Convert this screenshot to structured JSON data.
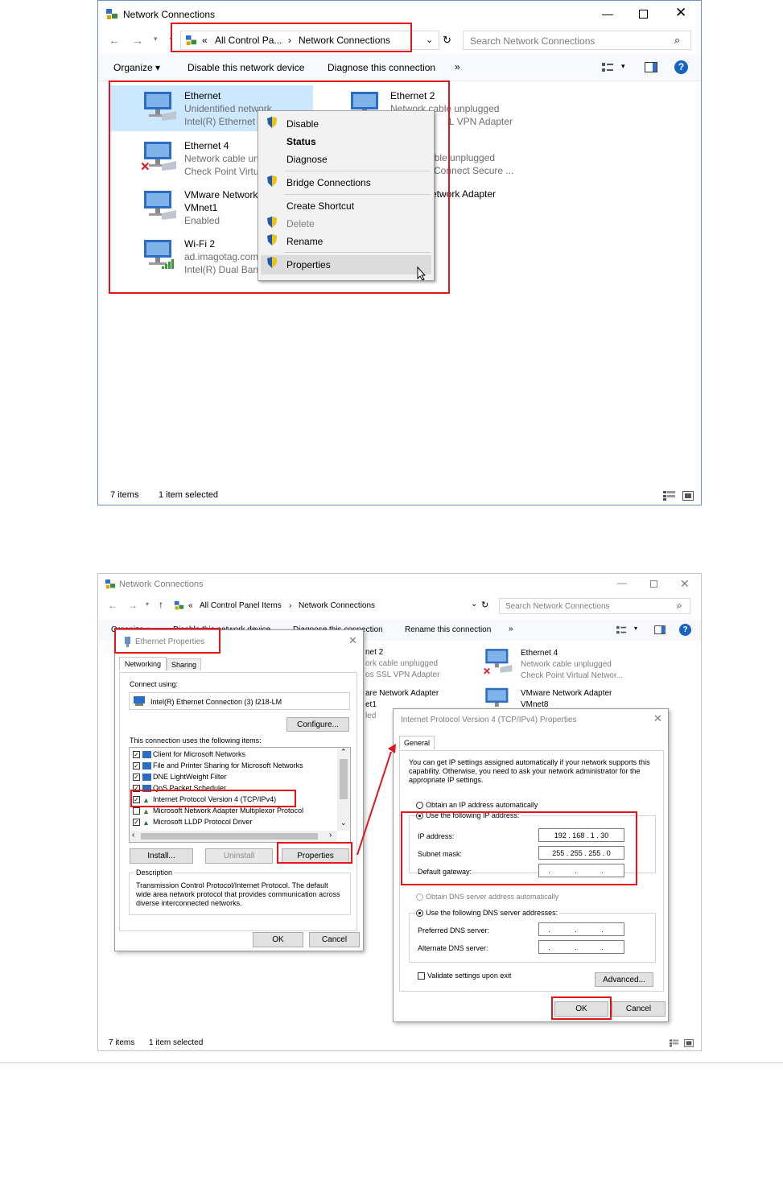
{
  "win1": {
    "title": "Network Connections",
    "breadcrumb_prefix": "«",
    "breadcrumb_parent": "All Control Pa...",
    "breadcrumb_sep": "›",
    "breadcrumb_current": "Network Connections",
    "search_placeholder": "Search Network Connections",
    "toolbar": {
      "organize": "Organize ▾",
      "disable": "Disable this network device",
      "diagnose": "Diagnose this connection",
      "more": "»"
    },
    "items": [
      {
        "name": "Ethernet",
        "line2": "Unidentified network",
        "line3": "Intel(R) Ethernet"
      },
      {
        "name": "Ethernet 4",
        "line2": "Network cable un",
        "line3": "Check Point Virtu"
      },
      {
        "name": "VMware Network",
        "line2": "VMnet1",
        "line3": "Enabled"
      },
      {
        "name": "Wi-Fi 2",
        "line2": "ad.imagotag.com",
        "line3": "Intel(R) Dual Band"
      },
      {
        "name": "Ethernet 2",
        "line2": "Network cable unplugged",
        "line3": "L VPN Adapter"
      },
      {
        "name": "",
        "line2": "able unplugged",
        "line3": "Connect Secure ..."
      },
      {
        "name": "etwork Adapter",
        "line2": "",
        "line3": ""
      }
    ],
    "context_menu": [
      "Disable",
      "Status",
      "Diagnose",
      "Bridge Connections",
      "Create Shortcut",
      "Delete",
      "Rename",
      "Properties"
    ],
    "status_items": "7 items",
    "status_selected": "1 item selected"
  },
  "win2": {
    "title": "Network Connections",
    "breadcrumb_prefix": "«",
    "breadcrumb_parent": "All Control Panel Items",
    "breadcrumb_sep": "›",
    "breadcrumb_current": "Network Connections",
    "search_placeholder": "Search Network Connections",
    "toolbar": {
      "organize": "Organize ▾",
      "disable": "Disable this network device",
      "diagnose": "Diagnose this connection",
      "rename": "Rename this connection",
      "more": "»"
    },
    "bg_items": [
      {
        "name": "net 2",
        "line2": "ork cable unplugged",
        "line3": "os SSL VPN Adapter"
      },
      {
        "name": "are Network Adapter",
        "line2": "et1",
        "line3": "led"
      },
      {
        "name": "Ethernet 4",
        "line2": "Network cable unplugged",
        "line3": "Check Point Virtual Networ..."
      },
      {
        "name": "VMware Network Adapter",
        "line2": "VMnet8",
        "line3": ""
      }
    ],
    "status_items": "7 items",
    "status_selected": "1 item selected"
  },
  "eth_props": {
    "title": "Ethernet Properties",
    "tab_networking": "Networking",
    "tab_sharing": "Sharing",
    "connect_using": "Connect using:",
    "adapter": "Intel(R) Ethernet Connection (3) I218-LM",
    "configure": "Configure...",
    "uses_label": "This connection uses the following items:",
    "items": [
      "Client for Microsoft Networks",
      "File and Printer Sharing for Microsoft Networks",
      "DNE LightWeight Filter",
      "QoS Packet Scheduler",
      "Internet Protocol Version 4 (TCP/IPv4)",
      "Microsoft Network Adapter Multiplexor Protocol",
      "Microsoft LLDP Protocol Driver"
    ],
    "install": "Install...",
    "uninstall": "Uninstall",
    "properties": "Properties",
    "description_label": "Description",
    "description": "Transmission Control Protocol/Internet Protocol. The default wide area network protocol that provides communication across diverse interconnected networks.",
    "ok": "OK",
    "cancel": "Cancel"
  },
  "ipv4": {
    "title": "Internet Protocol Version 4 (TCP/IPv4) Properties",
    "tab_general": "General",
    "intro": "You can get IP settings assigned automatically if your network supports this capability. Otherwise, you need to ask your network administrator for the appropriate IP settings.",
    "obtain_auto": "Obtain an IP address automatically",
    "use_following": "Use the following IP address:",
    "ip_label": "IP address:",
    "ip_value": "192 . 168 . 1 . 30",
    "mask_label": "Subnet mask:",
    "mask_value": "255 . 255 . 255 . 0",
    "gateway_label": "Default gateway:",
    "gateway_value": ". . .",
    "dns_auto": "Obtain DNS server address automatically",
    "dns_use": "Use the following DNS server addresses:",
    "preferred": "Preferred DNS server:",
    "preferred_value": ". . .",
    "alternate": "Alternate DNS server:",
    "alternate_value": ". . .",
    "validate": "Validate settings upon exit",
    "advanced": "Advanced...",
    "ok": "OK",
    "cancel": "Cancel"
  },
  "colors": {
    "highlight": "#e3141b",
    "selection": "#cce8ff",
    "help": "#1565c0"
  }
}
